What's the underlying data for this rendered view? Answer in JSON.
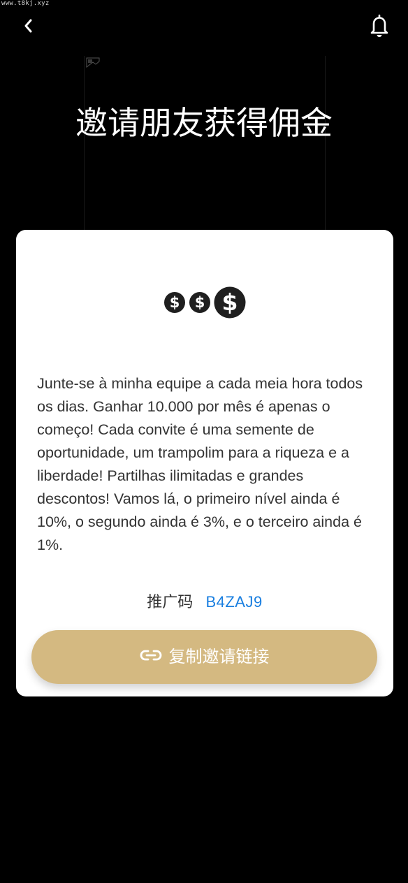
{
  "watermark": "www.t8kj.xyz",
  "header": {
    "back_icon": "chevron-left-icon",
    "notification_icon": "bell-icon"
  },
  "hero": {
    "title": "邀请朋友获得佣金"
  },
  "card": {
    "coins_icon": "dollar-coins-icon",
    "description": "Junte-se à minha equipe a cada meia hora todos os dias. Ganhar 10.000 por mês é apenas o começo! Cada convite é uma semente de oportunidade, um trampolim para a riqueza e a liberdade! Partilhas ilimitadas e grandes descontos! Vamos lá, o primeiro nível ainda é 10%, o segundo ainda é 3%, e o terceiro ainda é 1%.",
    "invite_label": "推广码",
    "invite_code": "B4ZAJ9",
    "copy_button_label": "复制邀请链接",
    "copy_button_icon": "link-icon"
  },
  "colors": {
    "background": "#000000",
    "card": "#ffffff",
    "accent_button": "#d4b981",
    "invite_code": "#1a7fe0",
    "text": "#333333"
  }
}
